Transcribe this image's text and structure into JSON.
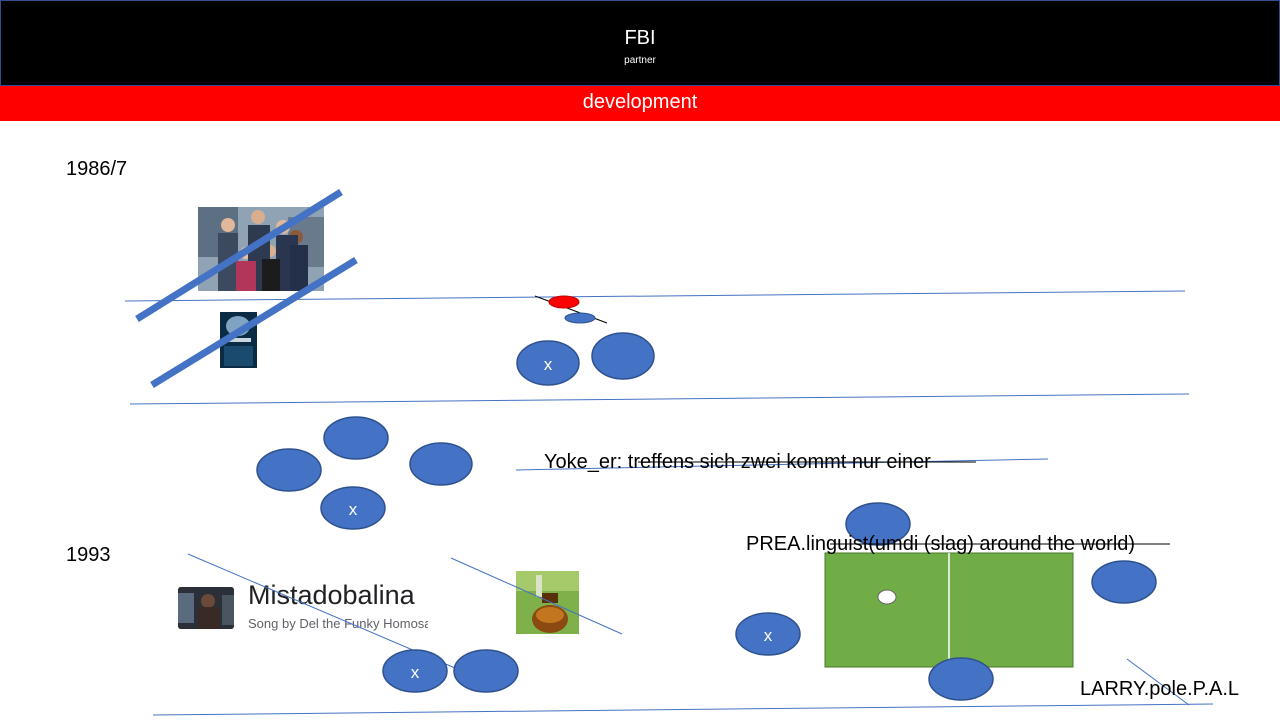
{
  "header": {
    "title": "FBI",
    "subtitle": "partner"
  },
  "band": {
    "text": "development"
  },
  "labels": {
    "year_1986": "1986/7",
    "year_1993": "1993",
    "yoke_line": "Yoke_er:  treffens sich zwei kommt nur einer",
    "prea_line": "PREA.linguist(umdi (slag) around the world)",
    "larry": "LARRY.pole.P.A.L"
  },
  "markers": {
    "x": "x"
  },
  "song_card": {
    "title": "Mistadobalina",
    "subtitle": "Song by Del the Funky Homosapien"
  },
  "colors": {
    "header_bg": "#000000",
    "band_red": "#ff0000",
    "circle_blue": "#4472c4",
    "field_green": "#70ad47",
    "line_blue": "#4472c4"
  },
  "icons": [
    "group-photo",
    "movie-poster-thumbnail",
    "music-video-thumbnail",
    "honey-jar-photo"
  ]
}
